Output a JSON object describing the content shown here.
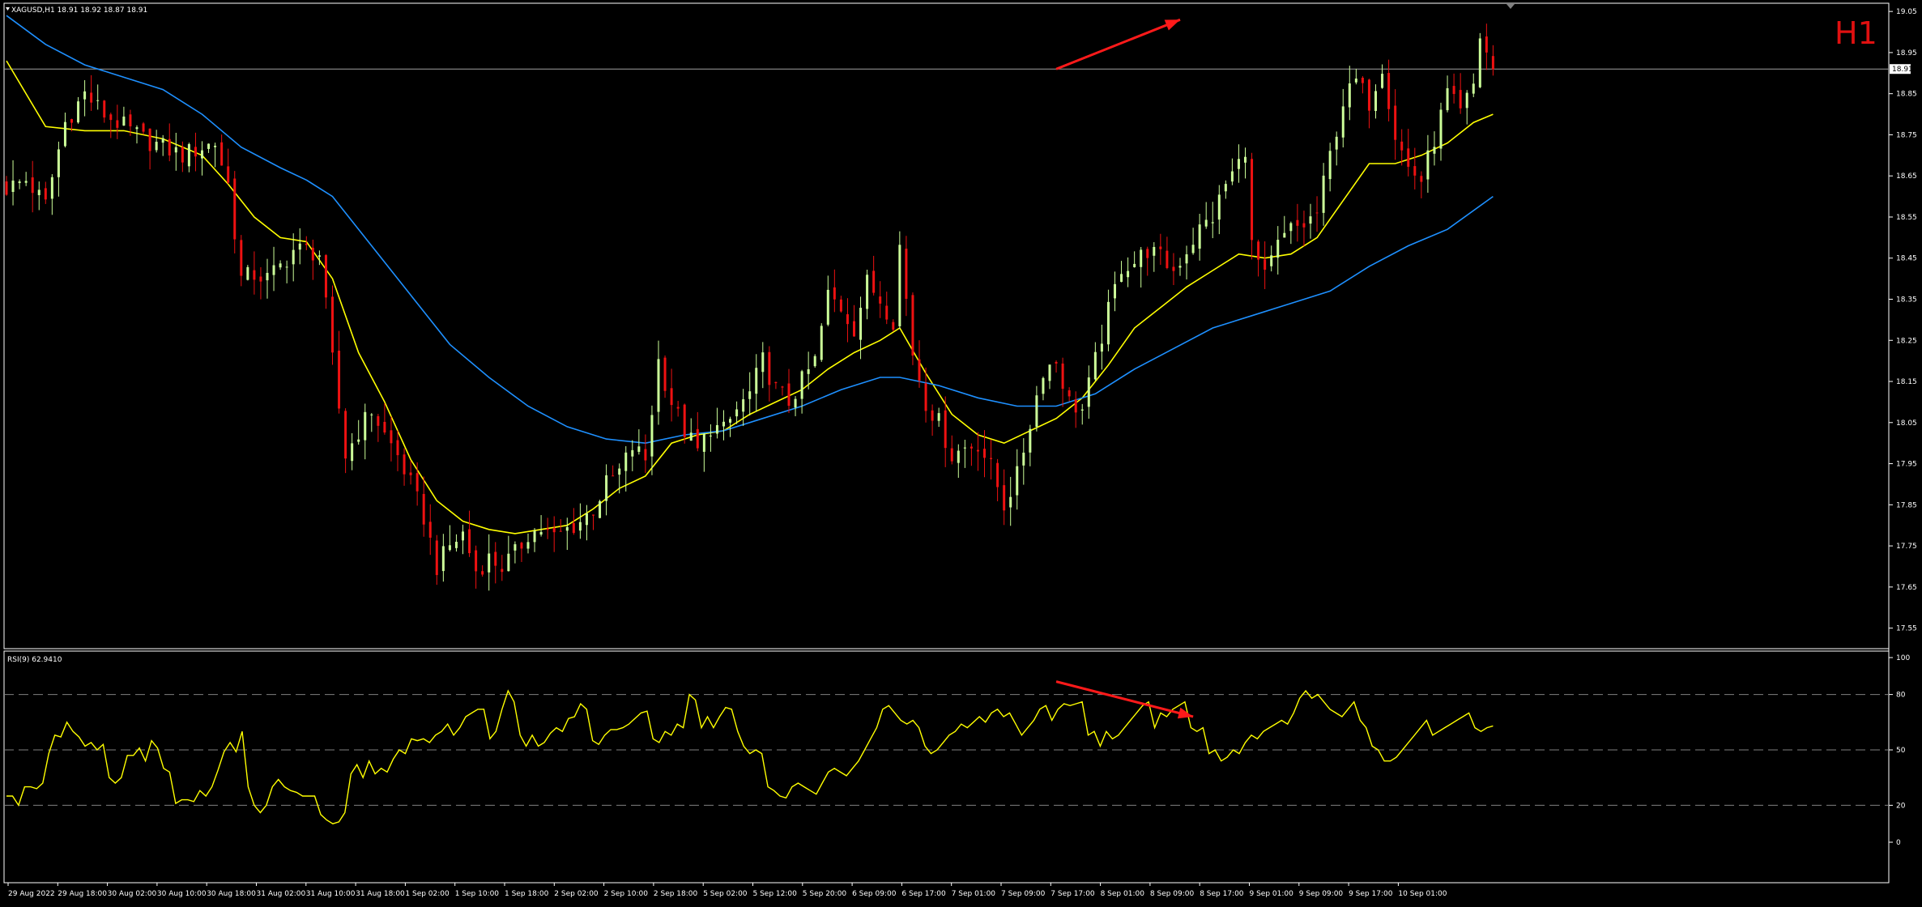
{
  "window": {
    "symbol_info": "XAGUSD,H1 18.91 18.92 18.87 18.91",
    "timeframe_badge": "H1",
    "current_price_label": "18.91"
  },
  "colors": {
    "background": "#000000",
    "bull": "#ccff99",
    "bear": "#ee1111",
    "ma_fast": "#ffff00",
    "ma_slow": "#1e90ff",
    "rsi": "#ffff00",
    "arrow": "#ff1a1a",
    "axis": "#ffffff",
    "grid": "#808080"
  },
  "chart_data": [
    {
      "type": "candlestick",
      "title": "XAGUSD,H1",
      "ylim": [
        17.5,
        19.07
      ],
      "y_ticks": [
        "19.05",
        "18.95",
        "18.85",
        "18.75",
        "18.65",
        "18.55",
        "18.45",
        "18.35",
        "18.25",
        "18.15",
        "18.05",
        "17.95",
        "17.85",
        "17.75",
        "17.65",
        "17.55"
      ],
      "x_ticks": [
        "29 Aug 2022",
        "29 Aug 18:00",
        "30 Aug 02:00",
        "30 Aug 10:00",
        "30 Aug 18:00",
        "31 Aug 02:00",
        "31 Aug 10:00",
        "31 Aug 18:00",
        "1 Sep 02:00",
        "1 Sep 10:00",
        "1 Sep 18:00",
        "2 Sep 02:00",
        "2 Sep 10:00",
        "2 Sep 18:00",
        "5 Sep 02:00",
        "5 Sep 12:00",
        "5 Sep 20:00",
        "6 Sep 09:00",
        "6 Sep 17:00",
        "7 Sep 01:00",
        "7 Sep 09:00",
        "7 Sep 17:00",
        "8 Sep 01:00",
        "8 Sep 09:00",
        "8 Sep 17:00",
        "9 Sep 01:00",
        "9 Sep 09:00",
        "9 Sep 17:00",
        "10 Sep 01:00"
      ],
      "current_price": 18.91,
      "close_path": [
        [
          0,
          18.62
        ],
        [
          3,
          18.64
        ],
        [
          6,
          18.58
        ],
        [
          9,
          18.78
        ],
        [
          12,
          18.85
        ],
        [
          15,
          18.8
        ],
        [
          18,
          18.77
        ],
        [
          21,
          18.74
        ],
        [
          24,
          18.72
        ],
        [
          27,
          18.7
        ],
        [
          30,
          18.72
        ],
        [
          32,
          18.73
        ],
        [
          34,
          18.63
        ],
        [
          36,
          18.4
        ],
        [
          38,
          18.41
        ],
        [
          40,
          18.4
        ],
        [
          42,
          18.43
        ],
        [
          44,
          18.47
        ],
        [
          46,
          18.47
        ],
        [
          48,
          18.46
        ],
        [
          50,
          18.2
        ],
        [
          52,
          17.97
        ],
        [
          54,
          18.03
        ],
        [
          56,
          18.08
        ],
        [
          58,
          18.02
        ],
        [
          60,
          17.97
        ],
        [
          62,
          17.9
        ],
        [
          64,
          17.82
        ],
        [
          66,
          17.7
        ],
        [
          68,
          17.75
        ],
        [
          70,
          17.78
        ],
        [
          72,
          17.69
        ],
        [
          74,
          17.72
        ],
        [
          76,
          17.7
        ],
        [
          78,
          17.73
        ],
        [
          80,
          17.78
        ],
        [
          82,
          17.79
        ],
        [
          84,
          17.77
        ],
        [
          86,
          17.79
        ],
        [
          88,
          17.81
        ],
        [
          90,
          17.84
        ],
        [
          92,
          17.9
        ],
        [
          94,
          17.93
        ],
        [
          96,
          17.99
        ],
        [
          98,
          17.96
        ],
        [
          100,
          18.2
        ],
        [
          102,
          18.1
        ],
        [
          104,
          18.03
        ],
        [
          106,
          17.98
        ],
        [
          108,
          18.04
        ],
        [
          110,
          18.03
        ],
        [
          112,
          18.08
        ],
        [
          114,
          18.12
        ],
        [
          116,
          18.2
        ],
        [
          118,
          18.13
        ],
        [
          120,
          18.1
        ],
        [
          122,
          18.15
        ],
        [
          124,
          18.2
        ],
        [
          126,
          18.36
        ],
        [
          128,
          18.33
        ],
        [
          130,
          18.28
        ],
        [
          132,
          18.39
        ],
        [
          134,
          18.35
        ],
        [
          136,
          18.3
        ],
        [
          137,
          18.48
        ],
        [
          139,
          18.22
        ],
        [
          141,
          18.1
        ],
        [
          143,
          18.05
        ],
        [
          145,
          17.97
        ],
        [
          147,
          17.99
        ],
        [
          149,
          18.0
        ],
        [
          151,
          17.94
        ],
        [
          153,
          17.85
        ],
        [
          155,
          17.92
        ],
        [
          157,
          18.05
        ],
        [
          159,
          18.18
        ],
        [
          161,
          18.2
        ],
        [
          163,
          18.1
        ],
        [
          165,
          18.08
        ],
        [
          167,
          18.2
        ],
        [
          169,
          18.32
        ],
        [
          171,
          18.43
        ],
        [
          173,
          18.44
        ],
        [
          175,
          18.47
        ],
        [
          177,
          18.45
        ],
        [
          179,
          18.42
        ],
        [
          181,
          18.47
        ],
        [
          183,
          18.52
        ],
        [
          185,
          18.55
        ],
        [
          187,
          18.63
        ],
        [
          189,
          18.68
        ],
        [
          190,
          18.72
        ],
        [
          191,
          18.48
        ],
        [
          193,
          18.4
        ],
        [
          195,
          18.48
        ],
        [
          197,
          18.52
        ],
        [
          199,
          18.53
        ],
        [
          201,
          18.56
        ],
        [
          203,
          18.7
        ],
        [
          205,
          18.83
        ],
        [
          207,
          18.88
        ],
        [
          209,
          18.83
        ],
        [
          211,
          18.92
        ],
        [
          213,
          18.75
        ],
        [
          215,
          18.67
        ],
        [
          217,
          18.64
        ],
        [
          219,
          18.74
        ],
        [
          221,
          18.85
        ],
        [
          223,
          18.8
        ],
        [
          225,
          18.87
        ],
        [
          226,
          18.99
        ],
        [
          228,
          18.91
        ]
      ],
      "series": [
        {
          "name": "MA fast",
          "color": "#ffff00",
          "points": [
            [
              0,
              18.93
            ],
            [
              6,
              18.77
            ],
            [
              12,
              18.76
            ],
            [
              18,
              18.76
            ],
            [
              24,
              18.74
            ],
            [
              30,
              18.7
            ],
            [
              34,
              18.63
            ],
            [
              38,
              18.55
            ],
            [
              42,
              18.5
            ],
            [
              46,
              18.49
            ],
            [
              50,
              18.4
            ],
            [
              54,
              18.22
            ],
            [
              58,
              18.1
            ],
            [
              62,
              17.96
            ],
            [
              66,
              17.86
            ],
            [
              70,
              17.81
            ],
            [
              74,
              17.79
            ],
            [
              78,
              17.78
            ],
            [
              82,
              17.79
            ],
            [
              86,
              17.8
            ],
            [
              90,
              17.84
            ],
            [
              94,
              17.89
            ],
            [
              98,
              17.92
            ],
            [
              102,
              18.0
            ],
            [
              106,
              18.02
            ],
            [
              110,
              18.03
            ],
            [
              114,
              18.07
            ],
            [
              118,
              18.1
            ],
            [
              122,
              18.13
            ],
            [
              126,
              18.18
            ],
            [
              130,
              18.22
            ],
            [
              134,
              18.25
            ],
            [
              137,
              18.28
            ],
            [
              141,
              18.17
            ],
            [
              145,
              18.07
            ],
            [
              149,
              18.02
            ],
            [
              153,
              18.0
            ],
            [
              157,
              18.03
            ],
            [
              161,
              18.06
            ],
            [
              165,
              18.11
            ],
            [
              169,
              18.19
            ],
            [
              173,
              18.28
            ],
            [
              177,
              18.33
            ],
            [
              181,
              18.38
            ],
            [
              185,
              18.42
            ],
            [
              189,
              18.46
            ],
            [
              193,
              18.45
            ],
            [
              197,
              18.46
            ],
            [
              201,
              18.5
            ],
            [
              205,
              18.59
            ],
            [
              209,
              18.68
            ],
            [
              213,
              18.68
            ],
            [
              217,
              18.7
            ],
            [
              221,
              18.73
            ],
            [
              225,
              18.78
            ],
            [
              228,
              18.8
            ]
          ]
        },
        {
          "name": "MA slow",
          "color": "#1e90ff",
          "points": [
            [
              0,
              19.04
            ],
            [
              6,
              18.97
            ],
            [
              12,
              18.92
            ],
            [
              18,
              18.89
            ],
            [
              24,
              18.86
            ],
            [
              30,
              18.8
            ],
            [
              36,
              18.72
            ],
            [
              42,
              18.67
            ],
            [
              46,
              18.64
            ],
            [
              50,
              18.6
            ],
            [
              56,
              18.48
            ],
            [
              62,
              18.36
            ],
            [
              68,
              18.24
            ],
            [
              74,
              18.16
            ],
            [
              80,
              18.09
            ],
            [
              86,
              18.04
            ],
            [
              92,
              18.01
            ],
            [
              98,
              18.0
            ],
            [
              104,
              18.02
            ],
            [
              110,
              18.03
            ],
            [
              116,
              18.06
            ],
            [
              122,
              18.09
            ],
            [
              128,
              18.13
            ],
            [
              134,
              18.16
            ],
            [
              137,
              18.16
            ],
            [
              143,
              18.14
            ],
            [
              149,
              18.11
            ],
            [
              155,
              18.09
            ],
            [
              161,
              18.09
            ],
            [
              167,
              18.12
            ],
            [
              173,
              18.18
            ],
            [
              179,
              18.23
            ],
            [
              185,
              18.28
            ],
            [
              191,
              18.31
            ],
            [
              197,
              18.34
            ],
            [
              203,
              18.37
            ],
            [
              209,
              18.43
            ],
            [
              215,
              18.48
            ],
            [
              221,
              18.52
            ],
            [
              228,
              18.6
            ]
          ]
        }
      ],
      "annotations": [
        {
          "type": "arrow",
          "from": [
            161,
            18.91
          ],
          "to": [
            180,
            19.03
          ]
        }
      ]
    },
    {
      "type": "line",
      "title": "RSI(9) 62.9410",
      "ylim": [
        0,
        100
      ],
      "y_ticks": [
        "100",
        "80",
        "50",
        "20",
        "0"
      ],
      "levels": [
        80,
        50,
        20
      ],
      "series": [
        {
          "name": "RSI(9)",
          "color": "#ffff00",
          "values": [
            25,
            25,
            20,
            30,
            30,
            29,
            32,
            48,
            58,
            57,
            65,
            60,
            57,
            52,
            54,
            50,
            53,
            35,
            32,
            35,
            47,
            47,
            51,
            44,
            55,
            51,
            40,
            38,
            21,
            23,
            23,
            22,
            28,
            25,
            30,
            39,
            49,
            54,
            49,
            60,
            30,
            20,
            16,
            20,
            30,
            34,
            30,
            28,
            27,
            25,
            25,
            25,
            15,
            12,
            10,
            11,
            16,
            37,
            42,
            35,
            44,
            37,
            40,
            38,
            45,
            50,
            48,
            56,
            55,
            56,
            54,
            58,
            60,
            64,
            58,
            62,
            68,
            70,
            72,
            72,
            56,
            60,
            72,
            82,
            76,
            58,
            52,
            58,
            52,
            54,
            59,
            62,
            60,
            67,
            68,
            75,
            72,
            55,
            53,
            58,
            61,
            61,
            62,
            64,
            67,
            70,
            71,
            56,
            54,
            60,
            58,
            64,
            62,
            80,
            77,
            62,
            68,
            62,
            68,
            73,
            72,
            60,
            52,
            48,
            50,
            48,
            30,
            28,
            25,
            24,
            30,
            32,
            30,
            28,
            26,
            32,
            38,
            40,
            38,
            36,
            40,
            44,
            50,
            56,
            62,
            72,
            74,
            70,
            66,
            64,
            66,
            62,
            52,
            48,
            50,
            54,
            58,
            60,
            64,
            62,
            65,
            68,
            65,
            70,
            72,
            68,
            70,
            64,
            58,
            62,
            66,
            72,
            74,
            66,
            72,
            75,
            74,
            75,
            76,
            58,
            60,
            52,
            60,
            56,
            58,
            62,
            66,
            70,
            74,
            76,
            62,
            70,
            68,
            72,
            74,
            76,
            62,
            60,
            62,
            48,
            50,
            44,
            46,
            50,
            48,
            54,
            58,
            56,
            60,
            62,
            64,
            66,
            64,
            70,
            78,
            82,
            78,
            80,
            76,
            72,
            70,
            68,
            72,
            76,
            66,
            62,
            52,
            50,
            44,
            44,
            46,
            50,
            54,
            58,
            62,
            66,
            58,
            60,
            62,
            64,
            66,
            68,
            70,
            62,
            60,
            62,
            63
          ]
        }
      ],
      "annotations": [
        {
          "type": "arrow",
          "from": [
            161,
            87
          ],
          "to": [
            182,
            68
          ]
        }
      ]
    }
  ]
}
